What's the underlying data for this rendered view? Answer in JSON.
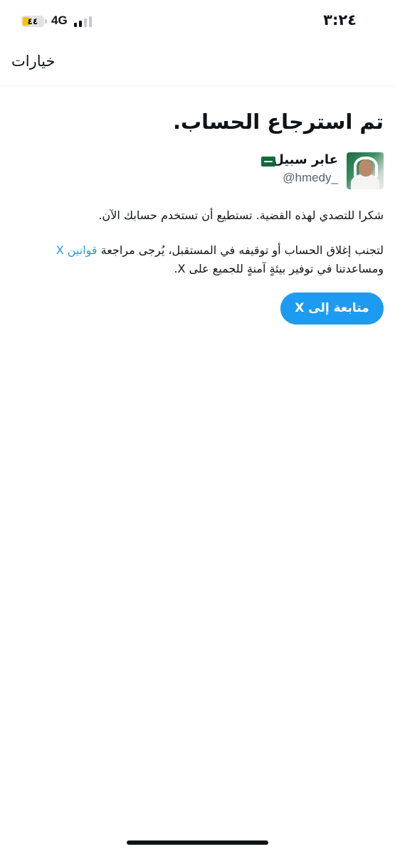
{
  "status_bar": {
    "time": "٣:٢٤",
    "network": "4G",
    "battery_level": "٤٤",
    "signal_bars_active": 2,
    "signal_bars_total": 4
  },
  "header": {
    "options_label": "خيارات"
  },
  "main": {
    "title": "تم استرجاع الحساب.",
    "account": {
      "display_name": "عابر سبيل",
      "handle": "@hmedy_"
    },
    "para1": "شكرا للتصدي لهذه القضية. تستطيع أن تستخدم حسابك الآن.",
    "para2_before": "لتجنب إغلاق الحساب أو توقيفه في المستقبل، يُرجى مراجعة ",
    "para2_link": "قوانين X",
    "para2_after": " ومساعدتنا في توفير بيئةٍ آمنةٍ للجميع على X.",
    "continue_button": "متابعة إلى X"
  },
  "colors": {
    "accent": "#1d9bf0",
    "text": "#0f1419",
    "secondary_text": "#536471",
    "battery_fill": "#f5c400"
  }
}
